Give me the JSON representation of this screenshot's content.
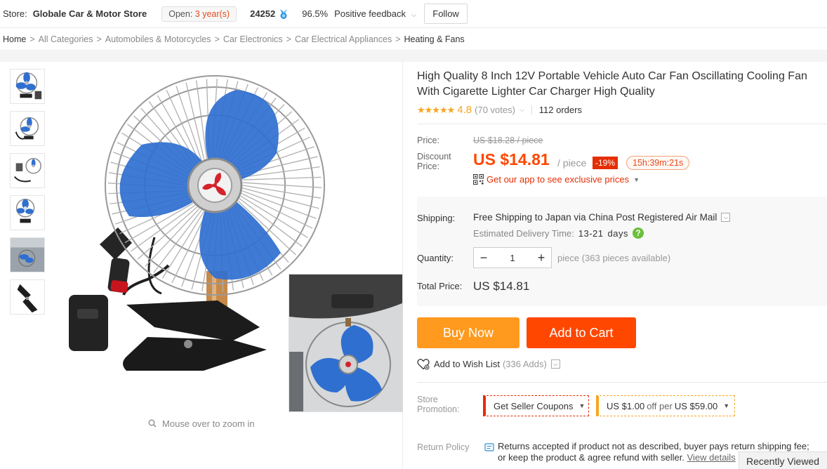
{
  "store": {
    "label": "Store:",
    "name": "Globale Car & Motor Store",
    "open_label": "Open:",
    "open_years": "3 year(s)",
    "score": "24252",
    "feedback_pct": "96.5%",
    "feedback_label": "Positive feedback",
    "follow_label": "Follow"
  },
  "breadcrumb": [
    "Home",
    "All Categories",
    "Automobiles & Motorcycles",
    "Car Electronics",
    "Car Electrical Appliances",
    "Heating & Fans"
  ],
  "gallery": {
    "zoom_hint": "Mouse over to zoom in"
  },
  "product": {
    "title": "High Quality 8 Inch 12V Portable Vehicle Auto Car Fan Oscillating Cooling Fan With Cigarette Lighter Car Charger High Quality",
    "rating": "4.8",
    "rating_fraction": 0.96,
    "votes": "(70 votes)",
    "orders": "112 orders"
  },
  "price": {
    "price_label": "Price:",
    "original": "US $18.28 / piece",
    "discount_label_1": "Discount",
    "discount_label_2": "Price:",
    "discount": "US $14.81",
    "per_piece": "/ piece",
    "off_pct": "-19%",
    "countdown": "15h:39m:21s",
    "app_promo": "Get our app to see exclusive prices"
  },
  "shipping": {
    "label": "Shipping:",
    "method": "Free Shipping to Japan via China Post Registered Air Mail",
    "est_label": "Estimated Delivery Time:",
    "est_days": "13-21",
    "est_unit": "days"
  },
  "quantity": {
    "label": "Quantity:",
    "value": "1",
    "minus": "−",
    "plus": "+",
    "available": "piece (363 pieces available)"
  },
  "total": {
    "label": "Total Price:",
    "value": "US $14.81"
  },
  "actions": {
    "buy_now": "Buy Now",
    "add_to_cart": "Add to Cart",
    "wishlist": "Add to Wish List",
    "wishlist_count": "(336 Adds)"
  },
  "promotion": {
    "label_1": "Store",
    "label_2": "Promotion:",
    "coupon": "Get Seller Coupons",
    "offer_amount": "US $1.00",
    "offer_mid": "off per",
    "offer_threshold": "US $59.00"
  },
  "return_policy": {
    "label": "Return Policy",
    "line1": "Returns accepted if product not as described, buyer pays return shipping fee;",
    "line2": "or keep the product & agree refund with seller.",
    "view": "View details"
  },
  "recently_viewed": "Recently Viewed",
  "colors": {
    "accent_orange": "#ff4700",
    "buy_now": "#ff9a1f",
    "star": "#f7a520",
    "badge_red": "#e62e04",
    "fan_blue": "#2f6fd0"
  }
}
